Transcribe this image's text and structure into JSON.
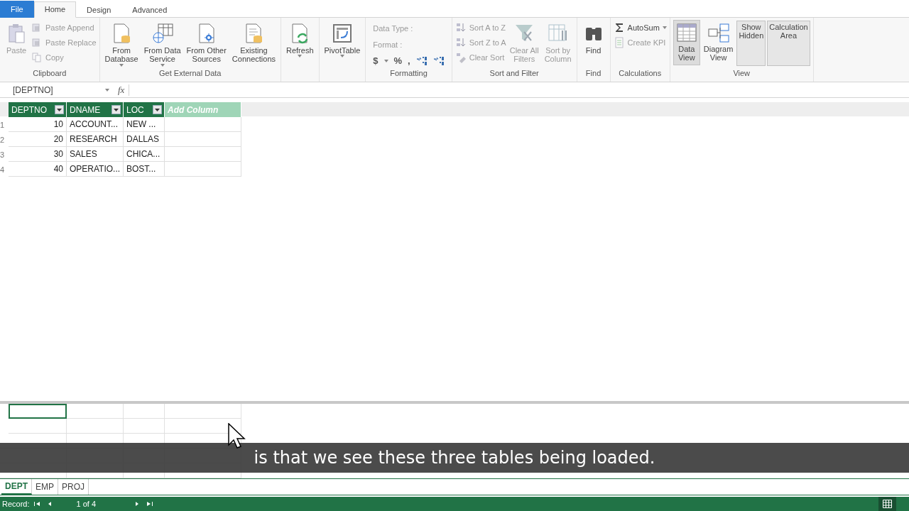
{
  "tabs": [
    {
      "label": "File",
      "kind": "file",
      "selected": false
    },
    {
      "label": "Home",
      "kind": "tab",
      "selected": true
    },
    {
      "label": "Design",
      "kind": "tab",
      "selected": false
    },
    {
      "label": "Advanced",
      "kind": "tab",
      "selected": false
    }
  ],
  "ribbon": {
    "groups": [
      {
        "label": "Clipboard",
        "columns": [
          {
            "kind": "large",
            "lines": [
              "Paste"
            ],
            "dropdown": false,
            "disabled": true
          },
          {
            "kind": "stack",
            "items": [
              {
                "label": "Paste Append",
                "dropdown": false,
                "disabled": true
              },
              {
                "label": "Paste Replace",
                "dropdown": false,
                "disabled": true
              },
              {
                "label": "Copy",
                "dropdown": false,
                "disabled": true
              }
            ]
          }
        ]
      },
      {
        "label": "Get External Data",
        "columns": [
          {
            "kind": "large",
            "lines": [
              "From",
              "Database"
            ],
            "dropdown": true,
            "disabled": false
          },
          {
            "kind": "large",
            "lines": [
              "From Data",
              "Service"
            ],
            "dropdown": true,
            "disabled": false
          },
          {
            "kind": "large",
            "lines": [
              "From Other",
              "Sources"
            ],
            "dropdown": false,
            "disabled": false
          },
          {
            "kind": "large",
            "lines": [
              "Existing",
              "Connections"
            ],
            "dropdown": false,
            "disabled": false
          }
        ]
      },
      {
        "columns": [
          {
            "kind": "large",
            "lines": [
              "Refresh"
            ],
            "dropdown": true,
            "disabled": false
          }
        ]
      },
      {
        "columns": [
          {
            "kind": "large",
            "lines": [
              "PivotTable"
            ],
            "dropdown": true,
            "disabled": false
          }
        ]
      },
      {
        "label": "Formatting",
        "columns": [
          {
            "kind": "format",
            "fields": [
              "Data Type :",
              "Format :"
            ],
            "symbols": [
              "$",
              "%",
              ","
            ],
            "disabled": true
          }
        ]
      },
      {
        "label": "Sort and Filter",
        "columns": [
          {
            "kind": "stack",
            "items": [
              {
                "label": "Sort A to Z",
                "dropdown": false,
                "disabled": true
              },
              {
                "label": "Sort Z to A",
                "dropdown": false,
                "disabled": true
              },
              {
                "label": "Clear Sort",
                "dropdown": false,
                "disabled": true
              }
            ]
          },
          {
            "kind": "large",
            "lines": [
              "Clear All",
              "Filters"
            ],
            "dropdown": false,
            "disabled": true
          },
          {
            "kind": "large",
            "lines": [
              "Sort by",
              "Column"
            ],
            "dropdown": false,
            "disabled": true
          }
        ]
      },
      {
        "label": "Find",
        "columns": [
          {
            "kind": "large",
            "lines": [
              "Find"
            ],
            "dropdown": false,
            "disabled": false
          }
        ]
      },
      {
        "label": "Calculations",
        "columns": [
          {
            "kind": "stack",
            "items": [
              {
                "label": "AutoSum",
                "dropdown": true,
                "disabled": false
              },
              {
                "label": "Create KPI",
                "dropdown": false,
                "disabled": true
              }
            ]
          }
        ]
      },
      {
        "label": "View",
        "columns": [
          {
            "kind": "view",
            "lines": [
              "Data",
              "View"
            ],
            "selected": true
          },
          {
            "kind": "view",
            "lines": [
              "Diagram",
              "View"
            ],
            "selected": false
          },
          {
            "kind": "toggle",
            "lines": [
              "Show",
              "Hidden"
            ],
            "on": true
          },
          {
            "kind": "toggle",
            "lines": [
              "Calculation",
              "Area"
            ],
            "on": true
          }
        ]
      }
    ]
  },
  "formula_bar": {
    "name_box": "[DEPTNO]",
    "function_label": "fx"
  },
  "table": {
    "columns": [
      {
        "label": "DEPTNO"
      },
      {
        "label": "DNAME"
      },
      {
        "label": "LOC"
      }
    ],
    "add_column": "Add Column",
    "rows": [
      {
        "number": "1",
        "cells": [
          "10",
          "ACCOUNT...",
          "NEW ..."
        ]
      },
      {
        "number": "2",
        "cells": [
          "20",
          "RESEARCH",
          "DALLAS"
        ]
      },
      {
        "number": "3",
        "cells": [
          "30",
          "SALES",
          "CHICA..."
        ]
      },
      {
        "number": "4",
        "cells": [
          "40",
          "OPERATIO...",
          "BOST..."
        ]
      }
    ]
  },
  "calculation_area": {
    "rows": [
      [
        {
          "selected": true
        },
        {
          "selected": false
        },
        {
          "selected": false
        },
        {
          "selected": false
        }
      ],
      [
        {
          "selected": false
        },
        {
          "selected": false
        },
        {
          "selected": false
        },
        {
          "selected": false
        }
      ]
    ]
  },
  "caption": "is that we see these three tables being loaded.",
  "sheet_tabs": [
    {
      "label": "DEPT",
      "selected": true
    },
    {
      "label": "EMP",
      "selected": false
    },
    {
      "label": "PROJ",
      "selected": false
    }
  ],
  "status_bar": {
    "record_label": "Record:",
    "position": "1 of 4"
  }
}
